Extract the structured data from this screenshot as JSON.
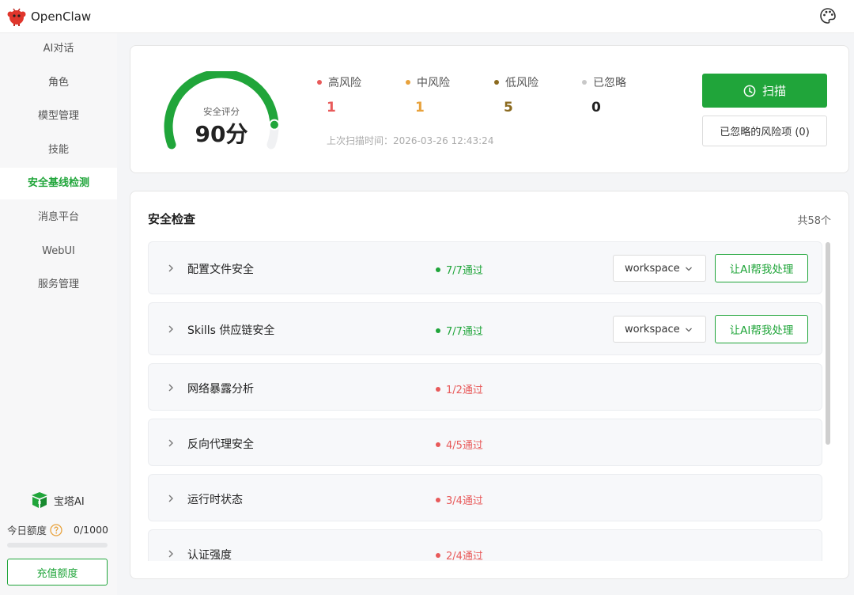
{
  "app": {
    "title": "OpenClaw"
  },
  "sidebar": {
    "items": [
      {
        "label": "AI对话"
      },
      {
        "label": "角色"
      },
      {
        "label": "模型管理"
      },
      {
        "label": "技能"
      },
      {
        "label": "安全基线检测",
        "active": true
      },
      {
        "label": "消息平台"
      },
      {
        "label": "WebUI"
      },
      {
        "label": "服务管理"
      }
    ],
    "brand_label": "宝塔AI",
    "quota_label": "今日额度",
    "quota_value": "0/1000",
    "quota_fraction": 0,
    "recharge_label": "充值额度"
  },
  "score": {
    "label": "安全评分",
    "value": "90分",
    "fraction": 0.9,
    "risks": [
      {
        "label": "高风险",
        "count": "1",
        "color": "#e85a5a"
      },
      {
        "label": "中风险",
        "count": "1",
        "color": "#e8a23c"
      },
      {
        "label": "低风险",
        "count": "5",
        "color": "#8b6a1f"
      },
      {
        "label": "已忽略",
        "count": "0",
        "color": "#c8c8c8"
      }
    ],
    "last_scan": "上次扫描时间：2026-03-26 12:43:24",
    "scan_label": "扫描",
    "ignored_label": "已忽略的风险项 (0)"
  },
  "checks": {
    "title": "安全检查",
    "total": "共58个",
    "rows": [
      {
        "name": "配置文件安全",
        "status": "7/7通过",
        "ok": true,
        "select": "workspace",
        "action": "让AI帮我处理"
      },
      {
        "name": "Skills 供应链安全",
        "status": "7/7通过",
        "ok": true,
        "select": "workspace",
        "action": "让AI帮我处理"
      },
      {
        "name": "网络暴露分析",
        "status": "1/2通过",
        "ok": false
      },
      {
        "name": "反向代理安全",
        "status": "4/5通过",
        "ok": false
      },
      {
        "name": "运行时状态",
        "status": "3/4通过",
        "ok": false
      },
      {
        "name": "认证强度",
        "status": "2/4通过",
        "ok": false
      }
    ]
  },
  "colors": {
    "accent": "#20a53a",
    "fail": "#e85a5a",
    "pass": "#20a53a"
  }
}
